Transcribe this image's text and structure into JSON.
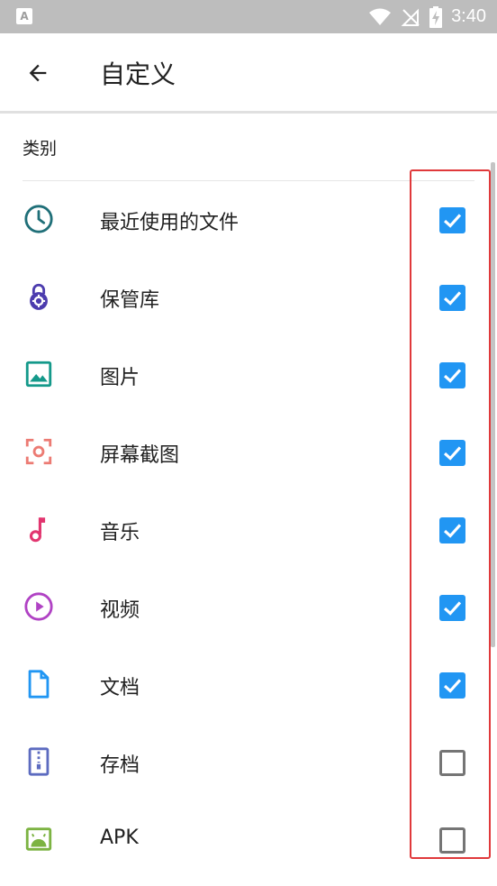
{
  "status_bar": {
    "left_icon_letter": "A",
    "time": "3:40",
    "icons": [
      "wifi-icon",
      "no-signal-icon",
      "battery-charging-icon"
    ]
  },
  "app_bar": {
    "back_icon": "arrow-back-icon",
    "title": "自定义"
  },
  "section": {
    "header": "类别"
  },
  "items": [
    {
      "label": "最近使用的文件",
      "icon": "clock-icon",
      "icon_color": "#1f6f78",
      "checked": true
    },
    {
      "label": "保管库",
      "icon": "vault-lock-icon",
      "icon_color": "#4c3cae",
      "checked": true
    },
    {
      "label": "图片",
      "icon": "image-icon",
      "icon_color": "#14998a",
      "checked": true
    },
    {
      "label": "屏幕截图",
      "icon": "screenshot-icon",
      "icon_color": "#ec7b73",
      "checked": true
    },
    {
      "label": "音乐",
      "icon": "music-note-icon",
      "icon_color": "#e2356f",
      "checked": true
    },
    {
      "label": "视频",
      "icon": "play-circle-icon",
      "icon_color": "#b042c4",
      "checked": true
    },
    {
      "label": "文档",
      "icon": "document-icon",
      "icon_color": "#2196f3",
      "checked": true
    },
    {
      "label": "存档",
      "icon": "archive-zip-icon",
      "icon_color": "#5c6bc0",
      "checked": false
    },
    {
      "label": "APK",
      "icon": "android-icon",
      "icon_color": "#7cb342",
      "checked": false
    }
  ],
  "colors": {
    "checkbox_checked": "#2196f3",
    "checkbox_unchecked_border": "#757575",
    "highlight_border": "#e0393b",
    "status_bar": "#bdbdbd"
  }
}
